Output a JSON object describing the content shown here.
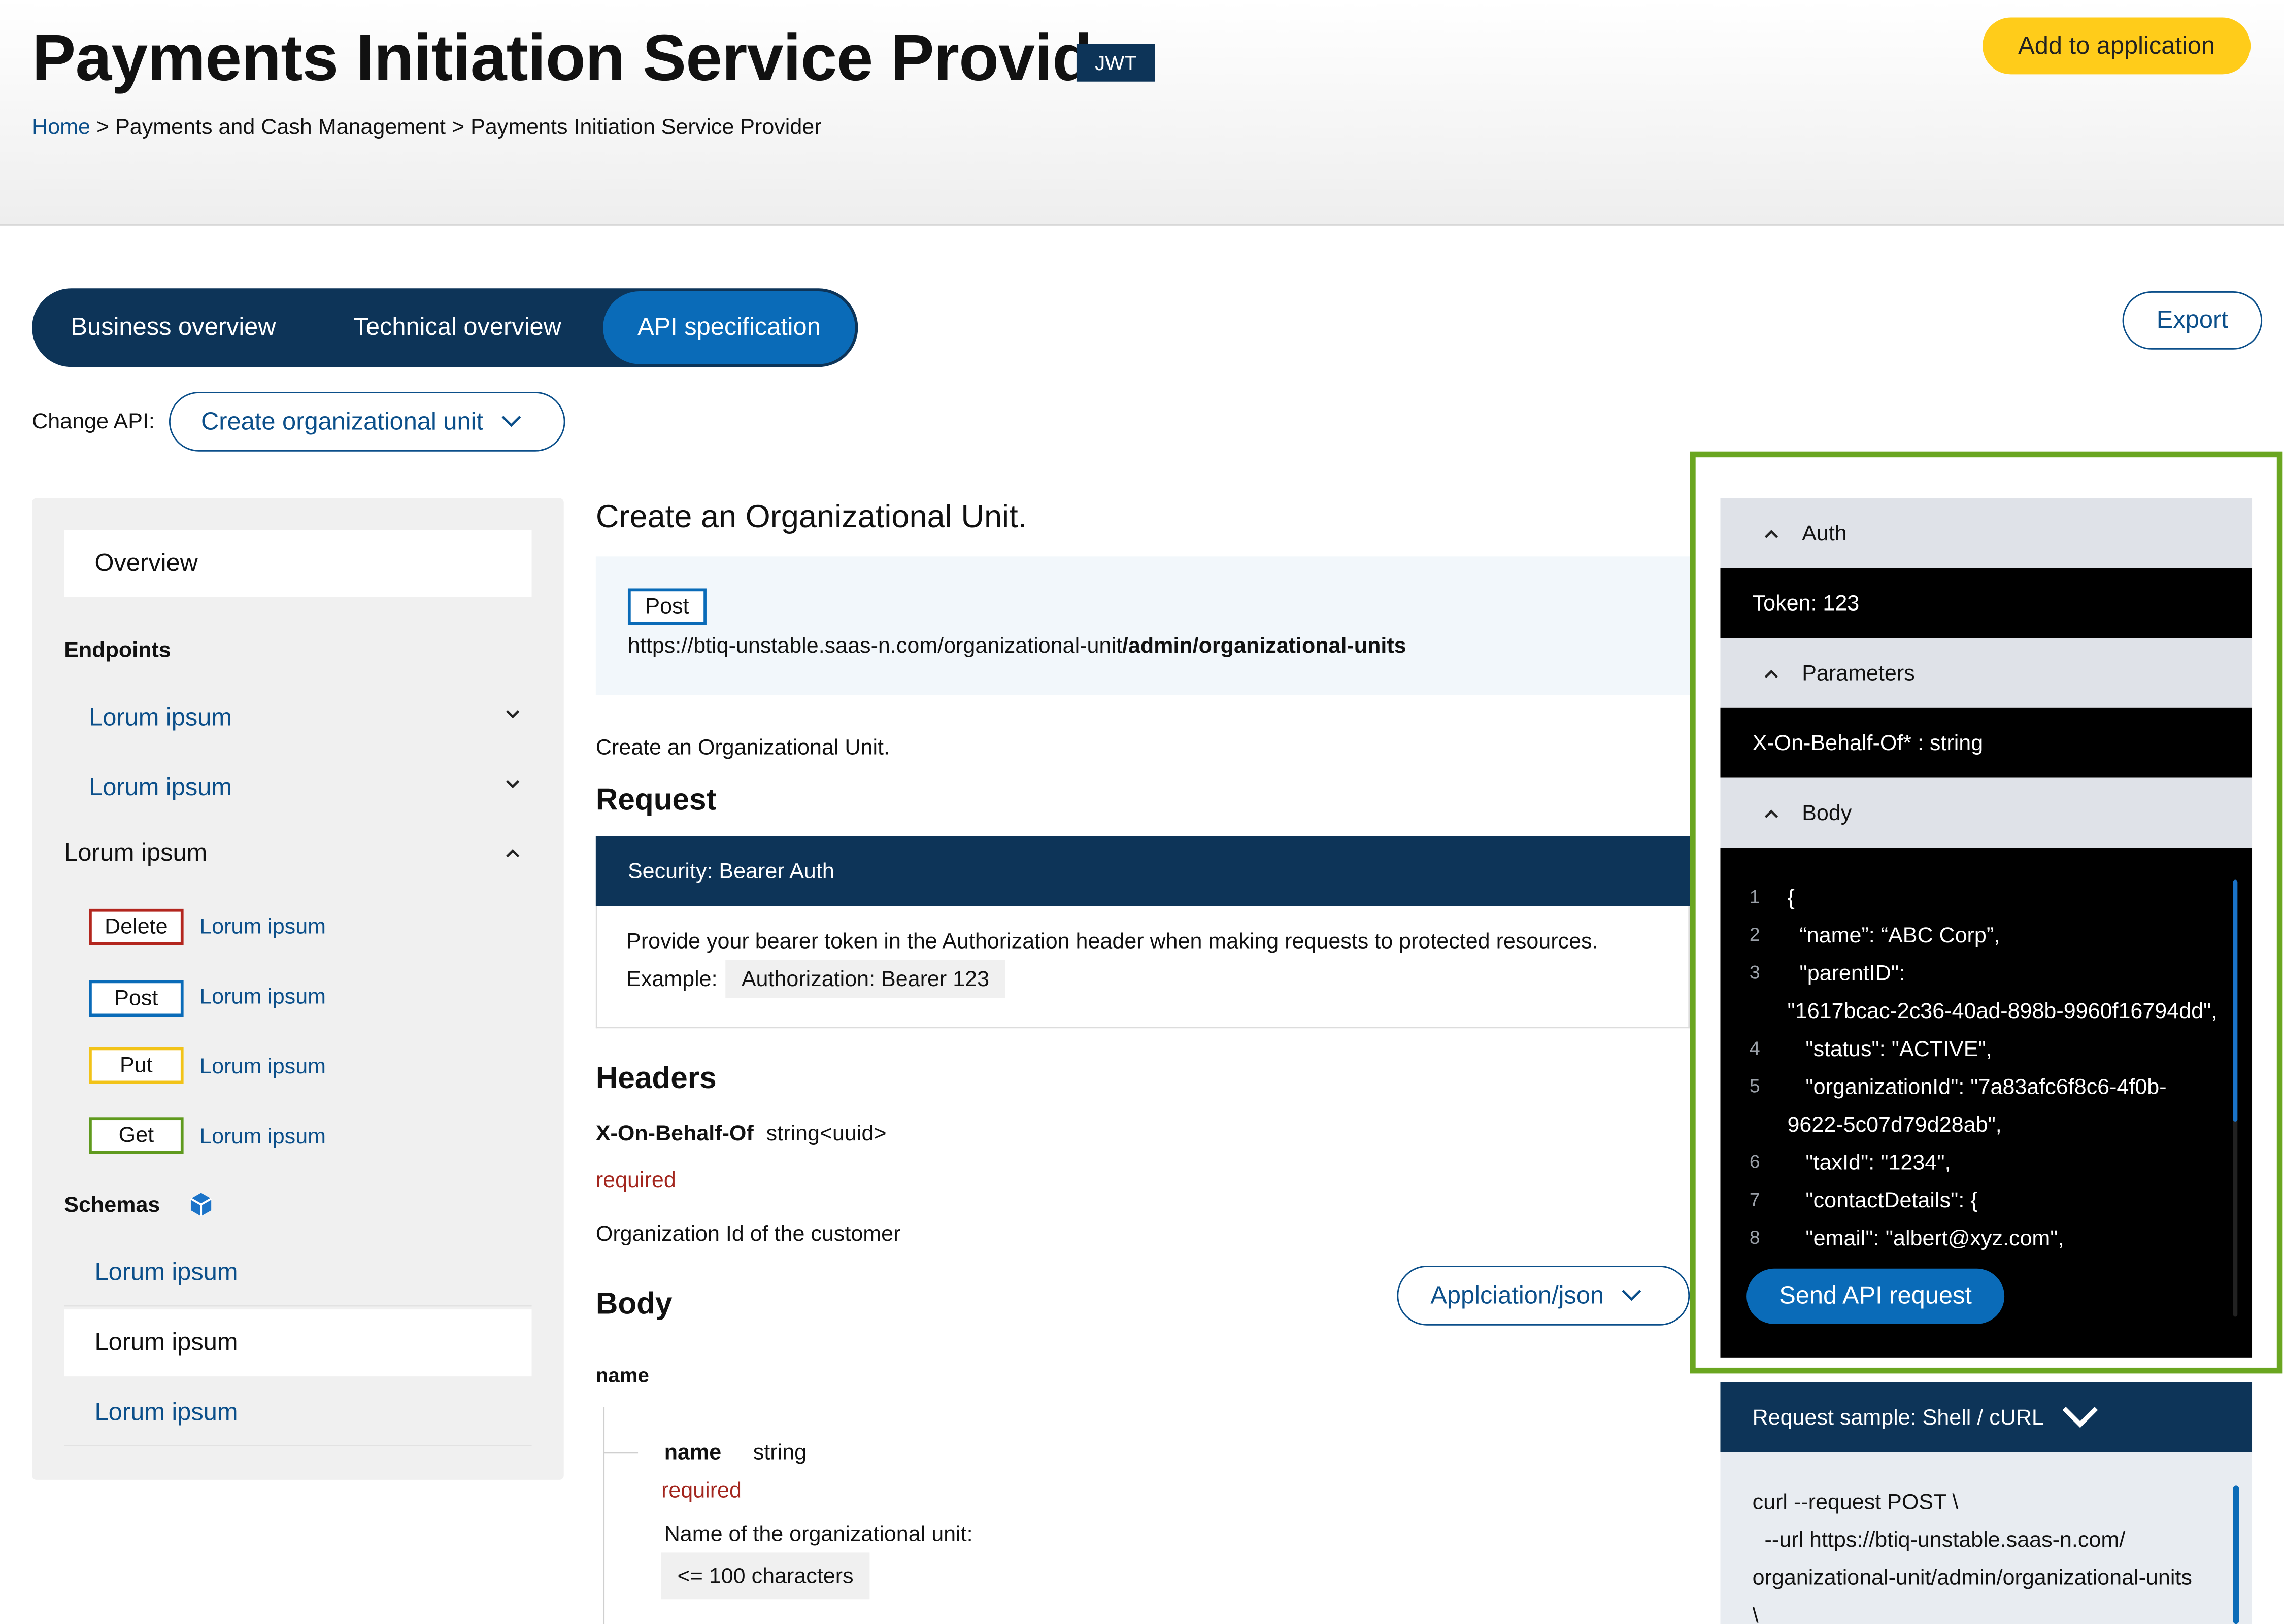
{
  "header": {
    "title": "Payments Initiation Service Provider",
    "badge": "JWT",
    "add_button": "Add to application",
    "breadcrumb": {
      "home": "Home",
      "sep1": " > ",
      "section": "Payments and Cash Management",
      "sep2": " > ",
      "current": "Payments Initiation Service Provider"
    }
  },
  "tabs": [
    {
      "label": "Business overview",
      "active": false
    },
    {
      "label": "Technical overview",
      "active": false
    },
    {
      "label": "API specification",
      "active": true
    }
  ],
  "export_label": "Export",
  "change_api": {
    "label": "Change API:",
    "value": "Create organizational unit"
  },
  "sidebar": {
    "overview": "Overview",
    "endpoints_heading": "Endpoints",
    "endpoint_items": [
      "Lorum ipsum",
      "Lorum ipsum"
    ],
    "group_label": "Lorum ipsum",
    "methods": [
      {
        "method": "Delete",
        "label": "Lorum ipsum",
        "color": "#b3261e"
      },
      {
        "method": "Post",
        "label": "Lorum ipsum",
        "color": "#0a6bb8"
      },
      {
        "method": "Put",
        "label": "Lorum ipsum",
        "color": "#f2c318"
      },
      {
        "method": "Get",
        "label": "Lorum ipsum",
        "color": "#5f9a1e"
      }
    ],
    "schemas_heading": "Schemas",
    "schema_items": [
      {
        "label": "Lorum ipsum",
        "selected": false
      },
      {
        "label": "Lorum ipsum",
        "selected": true
      },
      {
        "label": "Lorum ipsum",
        "selected": false
      }
    ]
  },
  "main": {
    "title": "Create an Organizational Unit.",
    "method": "Post",
    "url_base": "https://btiq-unstable.saas-n.com/organizational-unit",
    "url_path": "/admin/organizational-units",
    "description": "Create an Organizational Unit.",
    "request_heading": "Request",
    "security_label": "Security: Bearer Auth",
    "security_text": "Provide your bearer token in the Authorization header when making requests to protected resources.",
    "example_label": "Example:",
    "example_code": "Authorization: Bearer 123",
    "headers_heading": "Headers",
    "header_field": {
      "name": "X-On-Behalf-Of",
      "type": "string<uuid>",
      "required": "required",
      "description": "Organization Id of the customer"
    },
    "body_heading": "Body",
    "body_content_type": "Applciation/json",
    "body_group": "name",
    "body_field": {
      "name": "name",
      "type": "string",
      "required": "required",
      "description": "Name of the organizational unit:",
      "constraint": "<= 100 characters"
    }
  },
  "try_panel": {
    "auth_label": "Auth",
    "token_text": "Token: 123",
    "parameters_label": "Parameters",
    "param_text": "X-On-Behalf-Of* : string",
    "body_label": "Body",
    "code_lines": [
      {
        "n": "1",
        "t": "{"
      },
      {
        "n": "2",
        "t": "  “name”: “ABC Corp”,"
      },
      {
        "n": "3",
        "t": "  \"parentID\":"
      },
      {
        "n": "",
        "t": "\"1617bcac-2c36-40ad-898b-9960f16794dd\","
      },
      {
        "n": "4",
        "t": "   \"status\": \"ACTIVE\","
      },
      {
        "n": "5",
        "t": "   \"organizationId\": \"7a83afc6f8c6-4f0b-"
      },
      {
        "n": "",
        "t": "9622-5c07d79d28ab\","
      },
      {
        "n": "6",
        "t": "   \"taxId\": \"1234\","
      },
      {
        "n": "7",
        "t": "   \"contactDetails\": {"
      },
      {
        "n": "8",
        "t": "   \"email\": \"albert@xyz.com\","
      }
    ],
    "send_button": "Send API request"
  },
  "sample": {
    "label": "Request sample: Shell / cURL",
    "lines": [
      "curl --request POST \\",
      "  --url https://btiq-unstable.saas-n.com/",
      "organizational-unit/admin/organizational-units",
      "\\"
    ]
  },
  "colors": {
    "navy": "#0d3458",
    "accent_blue": "#0a6bb8",
    "yellow": "#ffcc1a",
    "highlight_green": "#6aa620",
    "required_red": "#a3261e"
  }
}
